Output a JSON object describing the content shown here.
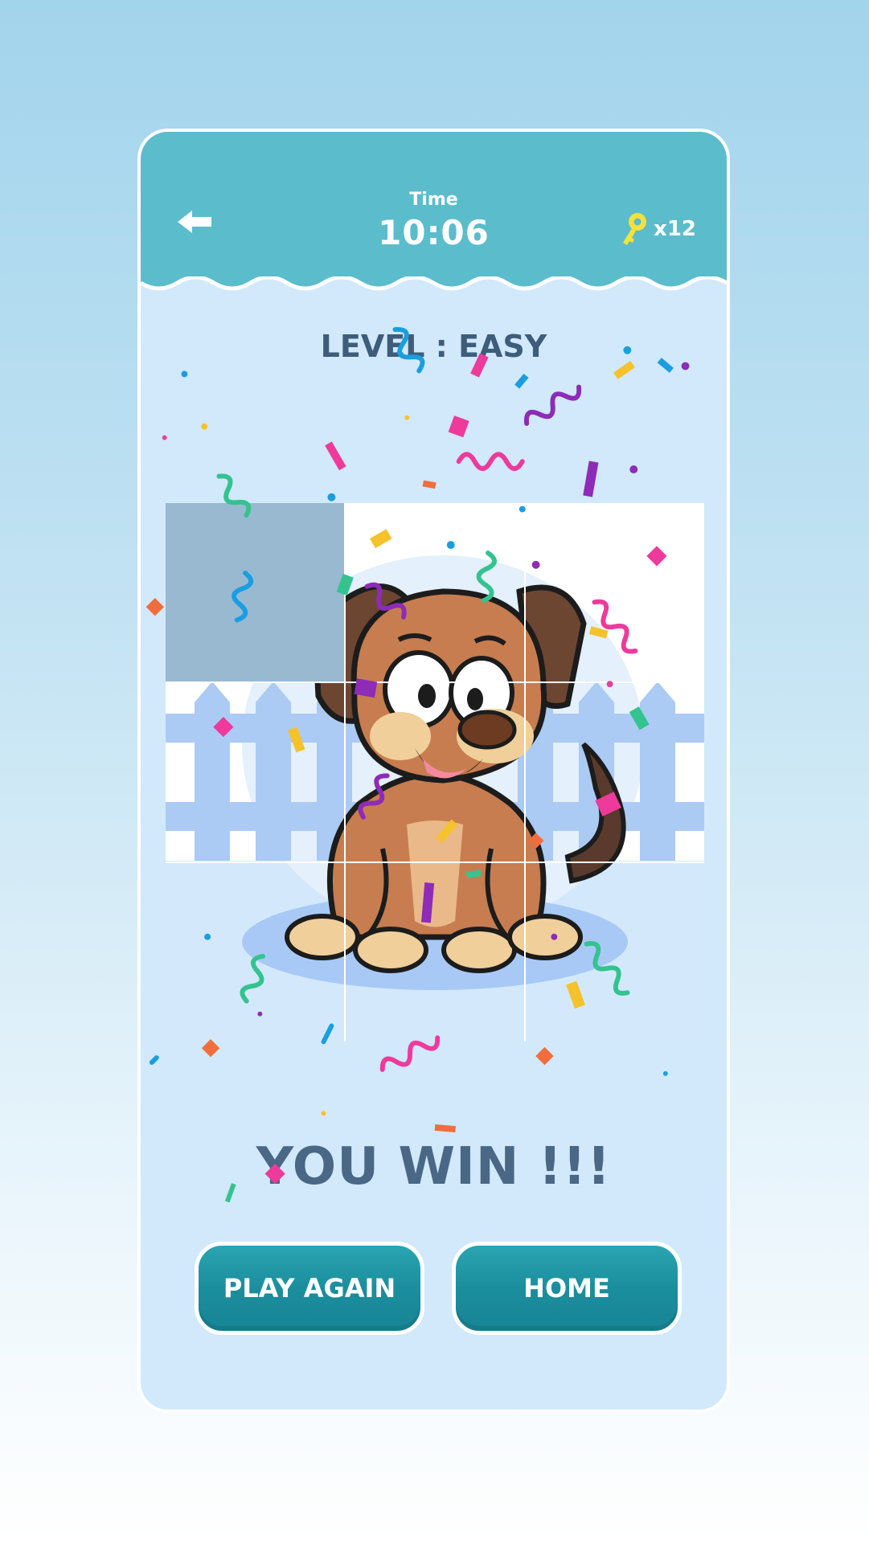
{
  "header": {
    "time_label": "Time",
    "time_value": "10:06",
    "keys": "x12",
    "back_icon": "arrow-left-icon",
    "key_icon": "key-icon"
  },
  "level": {
    "label": "LEVEL : EASY"
  },
  "puzzle": {
    "grid": "3x3",
    "image": "cartoon dog in front of fence",
    "solved": true
  },
  "result": {
    "text": "YOU WIN !!!"
  },
  "buttons": {
    "play_again": "PLAY AGAIN",
    "home": "HOME"
  },
  "colors": {
    "header": "#5bbccc",
    "panel": "#d1e9fa",
    "button": "#1b8e9d",
    "text_dark": "#4a6785",
    "key": "#f4e13c"
  }
}
